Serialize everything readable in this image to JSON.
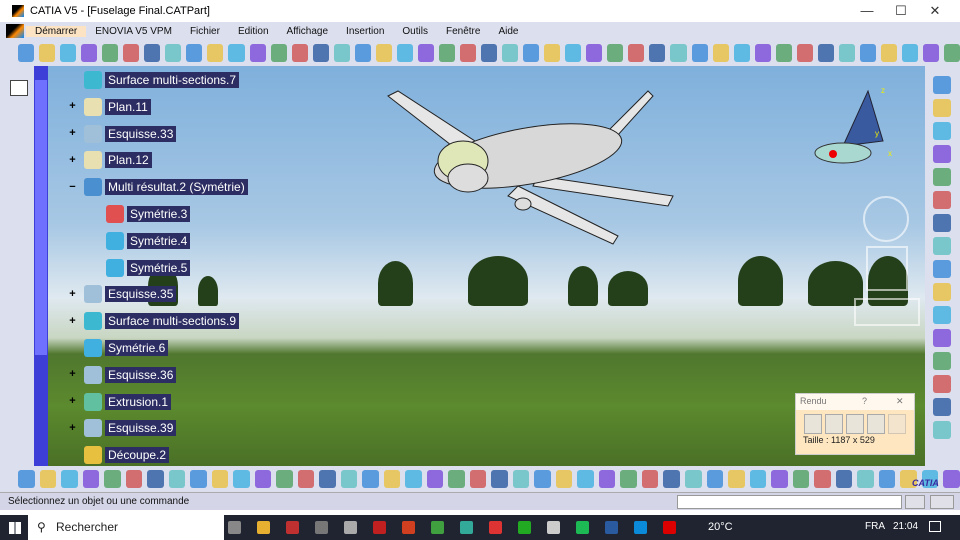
{
  "window": {
    "title": "CATIA V5 - [Fuselage Final.CATPart]",
    "controls": [
      "—",
      "☐",
      "✕"
    ]
  },
  "menu": [
    "Démarrer",
    "ENOVIA V5 VPM",
    "Fichier",
    "Edition",
    "Affichage",
    "Insertion",
    "Outils",
    "Fenêtre",
    "Aide"
  ],
  "tree": [
    {
      "label": "Surface multi-sections.7",
      "expander": "",
      "child": false,
      "color": "#3cb8d0"
    },
    {
      "label": "Plan.11",
      "expander": "+",
      "child": false,
      "color": "#e8e0b0"
    },
    {
      "label": "Esquisse.33",
      "expander": "+",
      "child": false,
      "color": "#9fc0d8"
    },
    {
      "label": "Plan.12",
      "expander": "+",
      "child": false,
      "color": "#e8e0b0"
    },
    {
      "label": "Multi résultat.2 (Symétrie)",
      "expander": "−",
      "child": false,
      "color": "#4a90d0"
    },
    {
      "label": "Symétrie.3",
      "expander": "",
      "child": true,
      "color": "#e05050"
    },
    {
      "label": "Symétrie.4",
      "expander": "",
      "child": true,
      "color": "#40b0e0"
    },
    {
      "label": "Symétrie.5",
      "expander": "",
      "child": true,
      "color": "#40b0e0"
    },
    {
      "label": "Esquisse.35",
      "expander": "+",
      "child": false,
      "color": "#9fc0d8"
    },
    {
      "label": "Surface multi-sections.9",
      "expander": "+",
      "child": false,
      "color": "#3cb8d0"
    },
    {
      "label": "Symétrie.6",
      "expander": "",
      "child": false,
      "color": "#40b0e0"
    },
    {
      "label": "Esquisse.36",
      "expander": "+",
      "child": false,
      "color": "#9fc0d8"
    },
    {
      "label": "Extrusion.1",
      "expander": "+",
      "child": false,
      "color": "#60c0a0"
    },
    {
      "label": "Esquisse.39",
      "expander": "+",
      "child": false,
      "color": "#9fc0d8"
    },
    {
      "label": "Découpe.2",
      "expander": "",
      "child": false,
      "color": "#e8c040"
    }
  ],
  "rendu": {
    "title": "Rendu",
    "help": "?",
    "close": "✕",
    "size": "Taille : 1187 x 529"
  },
  "status": {
    "message": "Sélectionnez un objet ou une commande"
  },
  "taskbar": {
    "search": "Rechercher",
    "weather": "20°C",
    "lang": "FRA",
    "time": "21:04"
  },
  "colors": {
    "tree_label_bg": "#2c2d62",
    "scroll": "#3d3dd8",
    "chrome": "#dcdfee"
  }
}
